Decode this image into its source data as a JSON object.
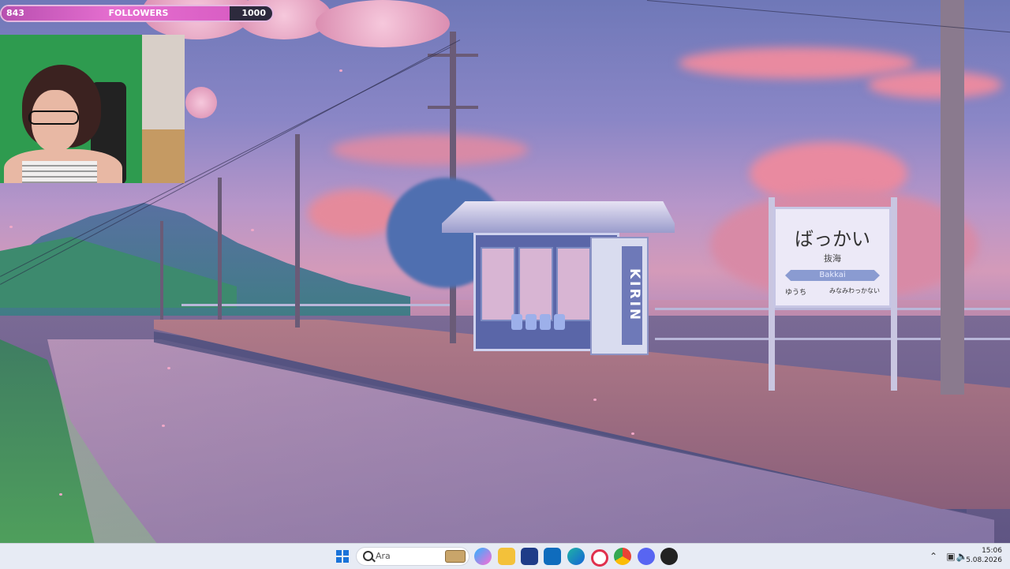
{
  "overlay": {
    "followers": {
      "current": "843",
      "label": "FOLLOWERS",
      "goal": "1000",
      "progress": 0.843
    }
  },
  "scene": {
    "sign": {
      "main": "ばっかい",
      "kanji": "抜海",
      "romaji": "Bakkai",
      "left_station": "ゆうち",
      "right_station": "みなみわっかない"
    },
    "vending_brand": "KIRIN"
  },
  "taskbar": {
    "search_placeholder": "Ara",
    "apps": [
      "windows-start",
      "file-explorer",
      "copilot",
      "folder",
      "microsoft-store",
      "outlook",
      "edge",
      "opera",
      "chrome",
      "discord",
      "obs"
    ],
    "time": "15:06",
    "date": "5.08.2026"
  },
  "colors": {
    "accent": "#d95ec4",
    "taskbar": "#e7ebf4"
  }
}
